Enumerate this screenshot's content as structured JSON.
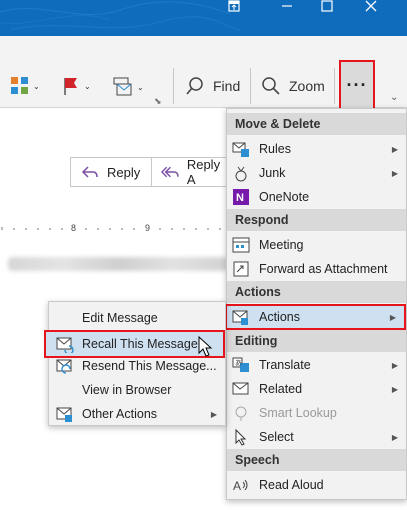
{
  "colors": {
    "title_bar": "#0f6cbd",
    "highlight_border": "#e5151b",
    "hover": "#cfe0f1"
  },
  "titlebar": {
    "controls": [
      "restore-icon",
      "minimize-icon",
      "maximize-icon",
      "close-icon"
    ]
  },
  "ribbon": {
    "find_label": "Find",
    "zoom_label": "Zoom",
    "more_label": "···"
  },
  "message": {
    "reply_label": "Reply",
    "reply_all_label": "Reply A",
    "ruler_marks": [
      "8",
      "9"
    ]
  },
  "menu": {
    "sections": [
      {
        "header": "Move & Delete",
        "items": [
          {
            "label": "Rules",
            "icon": "rules-icon",
            "submenu": true
          },
          {
            "label": "Junk",
            "icon": "junk-icon",
            "submenu": true
          },
          {
            "label": "OneNote",
            "icon": "onenote-icon",
            "submenu": false
          }
        ]
      },
      {
        "header": "Respond",
        "items": [
          {
            "label": "Meeting",
            "icon": "meeting-icon",
            "submenu": false
          },
          {
            "label": "Forward as Attachment",
            "icon": "forward-attachment-icon",
            "submenu": false
          }
        ]
      },
      {
        "header": "Actions",
        "items": [
          {
            "label": "Actions",
            "icon": "actions-icon",
            "submenu": true
          }
        ]
      },
      {
        "header": "Editing",
        "items": [
          {
            "label": "Translate",
            "icon": "translate-icon",
            "submenu": true
          },
          {
            "label": "Related",
            "icon": "related-icon",
            "submenu": true
          },
          {
            "label": "Smart Lookup",
            "icon": "smart-lookup-icon",
            "submenu": false,
            "disabled": true
          },
          {
            "label": "Select",
            "icon": "select-icon",
            "submenu": true
          }
        ]
      },
      {
        "header": "Speech",
        "items": [
          {
            "label": "Read Aloud",
            "icon": "read-aloud-icon",
            "submenu": false
          }
        ]
      }
    ]
  },
  "submenu": {
    "items": [
      {
        "label": "Edit Message",
        "icon": ""
      },
      {
        "label": "Recall This Message...",
        "icon": "recall-icon"
      },
      {
        "label": "Resend This Message...",
        "icon": "resend-icon"
      },
      {
        "label": "View in Browser",
        "icon": ""
      },
      {
        "label": "Other Actions",
        "icon": "other-actions-icon",
        "submenu": true
      }
    ]
  }
}
